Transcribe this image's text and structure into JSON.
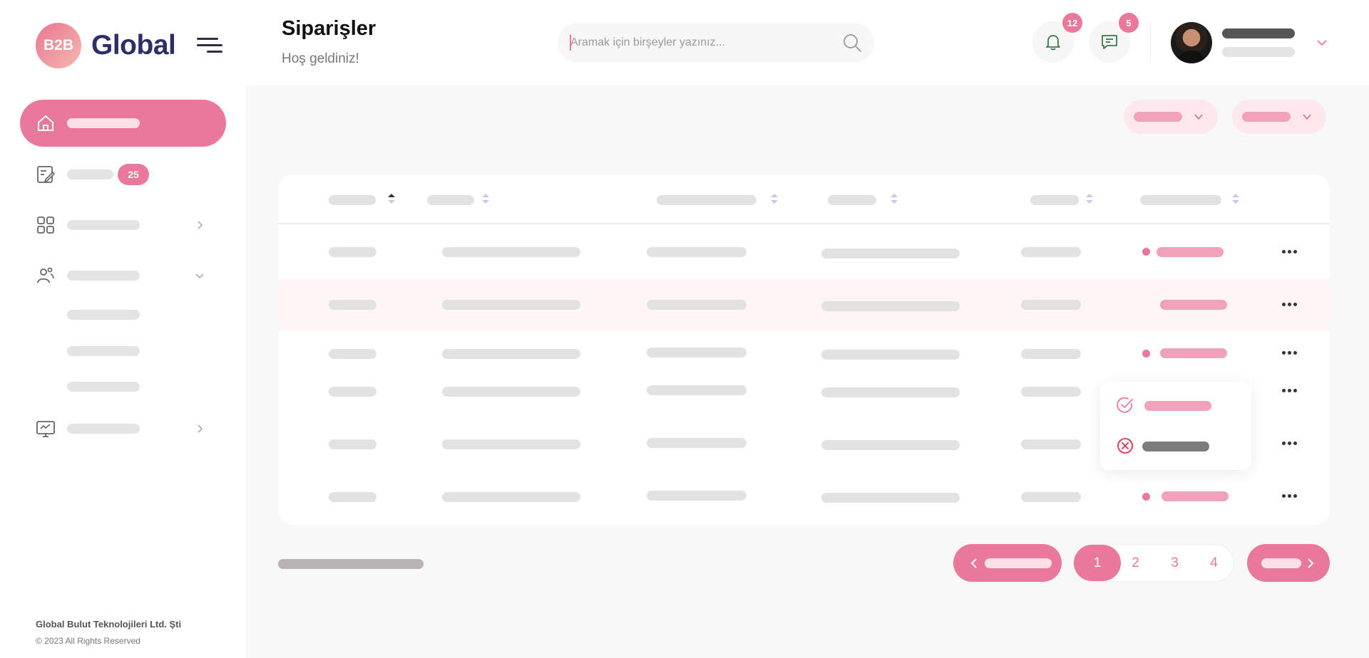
{
  "brand": {
    "badge": "B2B",
    "name": "Global"
  },
  "header": {
    "title": "Siparişler",
    "subtitle": "Hoş geldiniz!",
    "search_placeholder": "Aramak için birşeyler yazınız...",
    "notifications_count": "12",
    "messages_count": "5"
  },
  "sidebar": {
    "orders_badge": "25"
  },
  "pagination": {
    "pages": [
      "1",
      "2",
      "3",
      "4"
    ],
    "active_page": "1"
  },
  "footer": {
    "company": "Global Bulut Teknolojileri Ltd. Şti",
    "copyright": "© 2023 All Rights Reserved"
  },
  "colors": {
    "accent": "#e9789a",
    "accent_light": "#fde8ee",
    "brand_text": "#2d2e6a",
    "row_highlight": "#fff5f5"
  },
  "icons": {
    "nav": [
      "home-icon",
      "document-edit-icon",
      "grid-icon",
      "users-icon",
      "monitor-icon"
    ],
    "header": [
      "search-icon",
      "bell-icon",
      "message-icon",
      "chevron-down-icon"
    ],
    "popup": [
      "check-circle-icon",
      "x-circle-icon"
    ]
  }
}
